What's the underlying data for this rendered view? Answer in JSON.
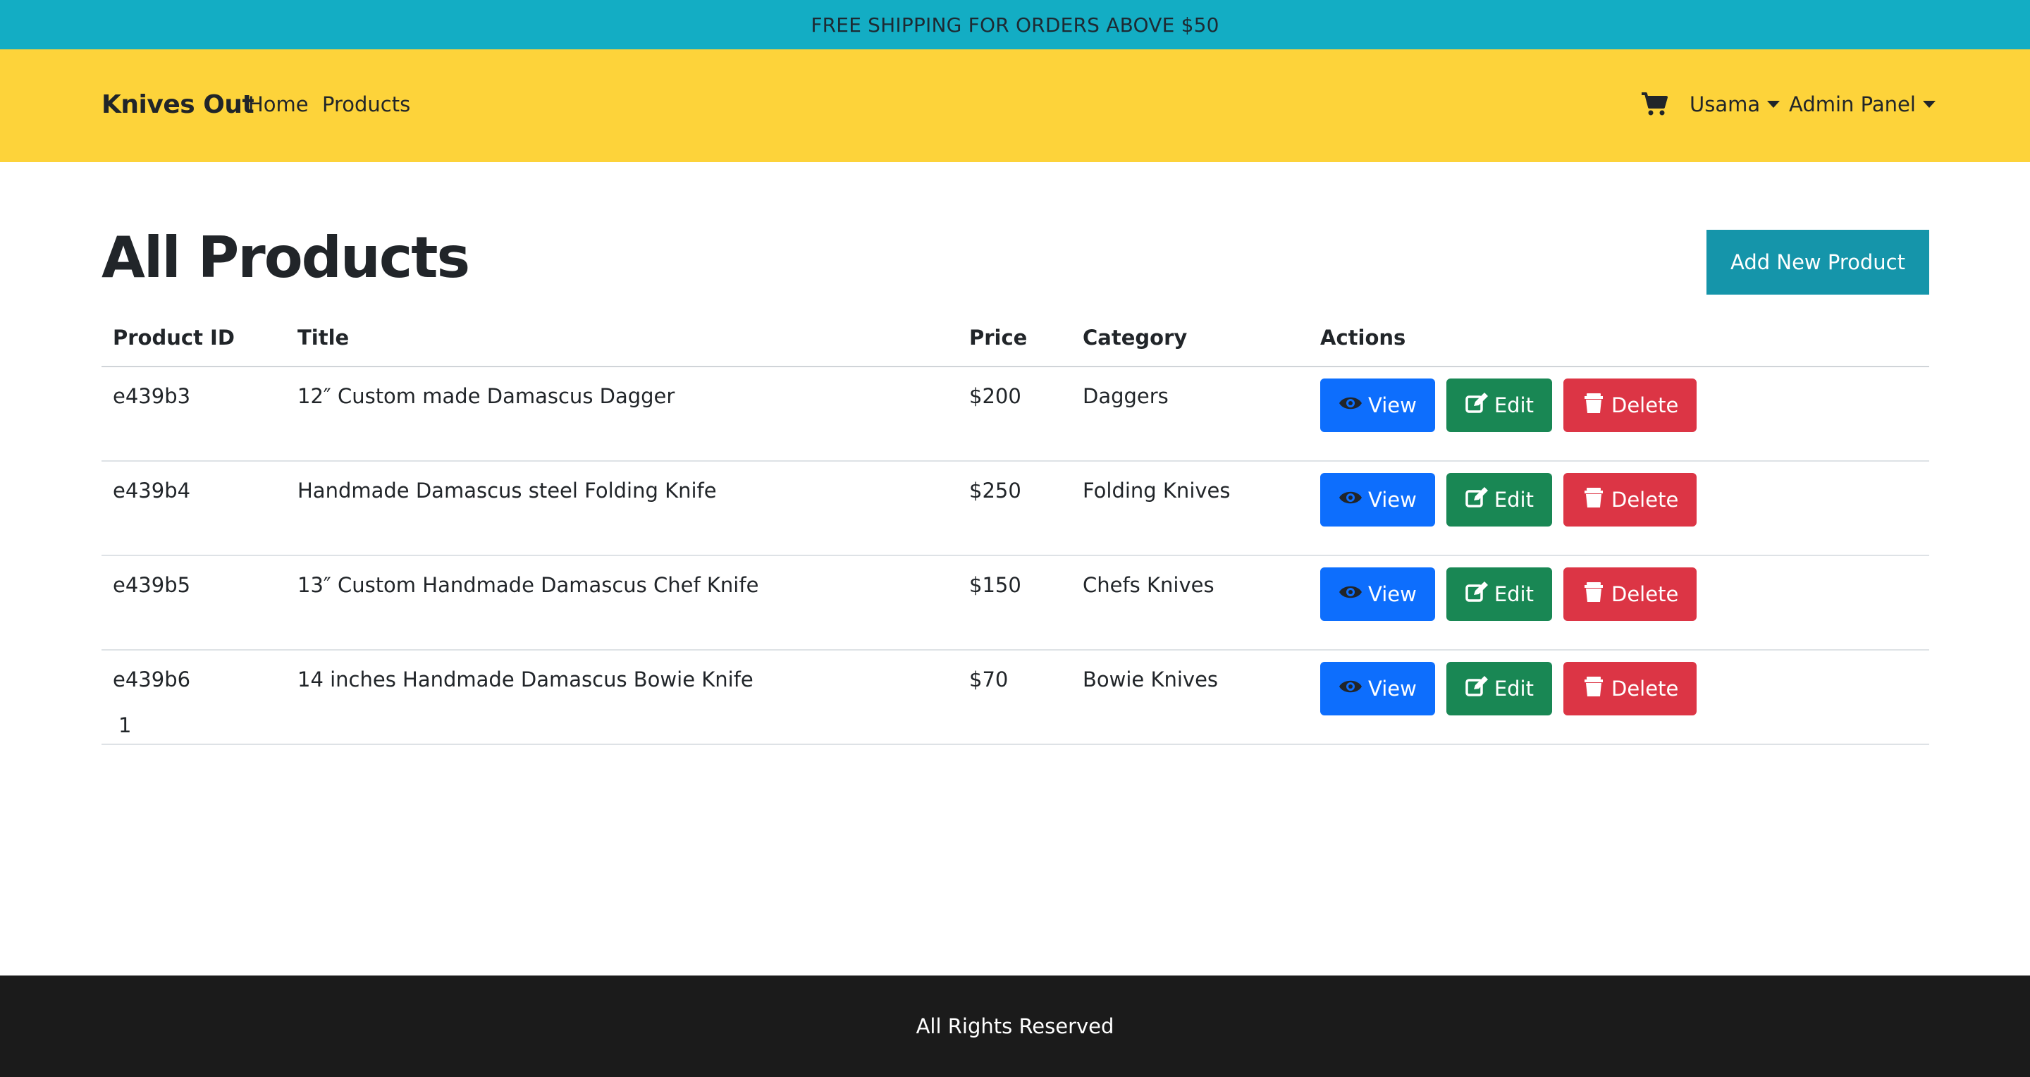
{
  "announcement": "FREE SHIPPING FOR ORDERS ABOVE $50",
  "navbar": {
    "brand": "Knives Out",
    "links": [
      "Home",
      "Products"
    ],
    "cart_icon": "shopping-cart-icon",
    "user_menu": "Usama",
    "admin_menu": "Admin Panel"
  },
  "page": {
    "title": "All Products",
    "add_button": "Add New Product"
  },
  "table": {
    "headers": [
      "Product ID",
      "Title",
      "Price",
      "Category",
      "Actions"
    ],
    "rows": [
      {
        "id": "e439b3",
        "title": "12″ Custom made Damascus Dagger",
        "price": "$200",
        "category": "Daggers"
      },
      {
        "id": "e439b4",
        "title": "Handmade Damascus steel Folding Knife",
        "price": "$250",
        "category": "Folding Knives"
      },
      {
        "id": "e439b5",
        "title": "13″ Custom Handmade Damascus Chef Knife",
        "price": "$150",
        "category": "Chefs Knives"
      },
      {
        "id": "e439b6",
        "title": "14 inches Handmade Damascus Bowie Knife",
        "price": "$70",
        "category": "Bowie Knives"
      }
    ],
    "actions": {
      "view": "View",
      "edit": "Edit",
      "delete": "Delete"
    }
  },
  "pagination": {
    "current_page": "1"
  },
  "footer": "All Rights Reserved",
  "colors": {
    "announcement_bg": "#13adc4",
    "navbar_bg": "#fdd33a",
    "add_button_bg": "#1595aa",
    "view_bg": "#0d6efd",
    "edit_bg": "#198754",
    "delete_bg": "#dc3545",
    "footer_bg": "#1b1b1b"
  }
}
